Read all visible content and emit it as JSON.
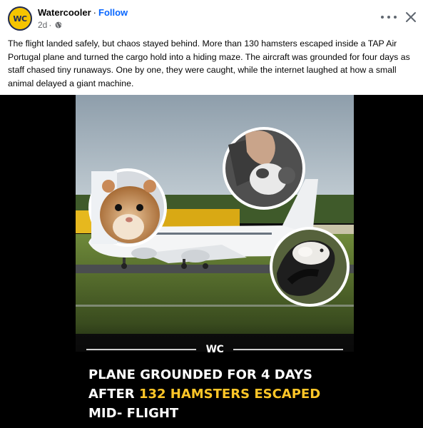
{
  "header": {
    "avatar_text": "WC",
    "page_name": "Watercooler",
    "separator": "·",
    "follow_label": "Follow",
    "time": "2d",
    "time_separator": "·"
  },
  "caption": "The flight landed safely, but chaos stayed behind. More than 130 hamsters escaped inside a TAP Air Portugal plane and turned the cargo hold into a hiding maze. The aircraft was grounded for four days as staff chased tiny runaways. One by one, they were caught, while the internet laughed at how a small animal delayed a giant machine.",
  "media": {
    "brand_logo": "WC",
    "headline_line1": "PLANE GROUNDED FOR 4 DAYS",
    "headline_line2_prefix": "AFTER ",
    "headline_line2_highlight": "132 HAMSTERS ESCAPED",
    "headline_line3": "MID- FLIGHT"
  },
  "colors": {
    "link_blue": "#0866ff",
    "highlight_yellow": "#ffc628",
    "avatar_yellow": "#f5c400"
  },
  "icons": [
    "globe-icon",
    "more-options-icon",
    "close-icon"
  ]
}
